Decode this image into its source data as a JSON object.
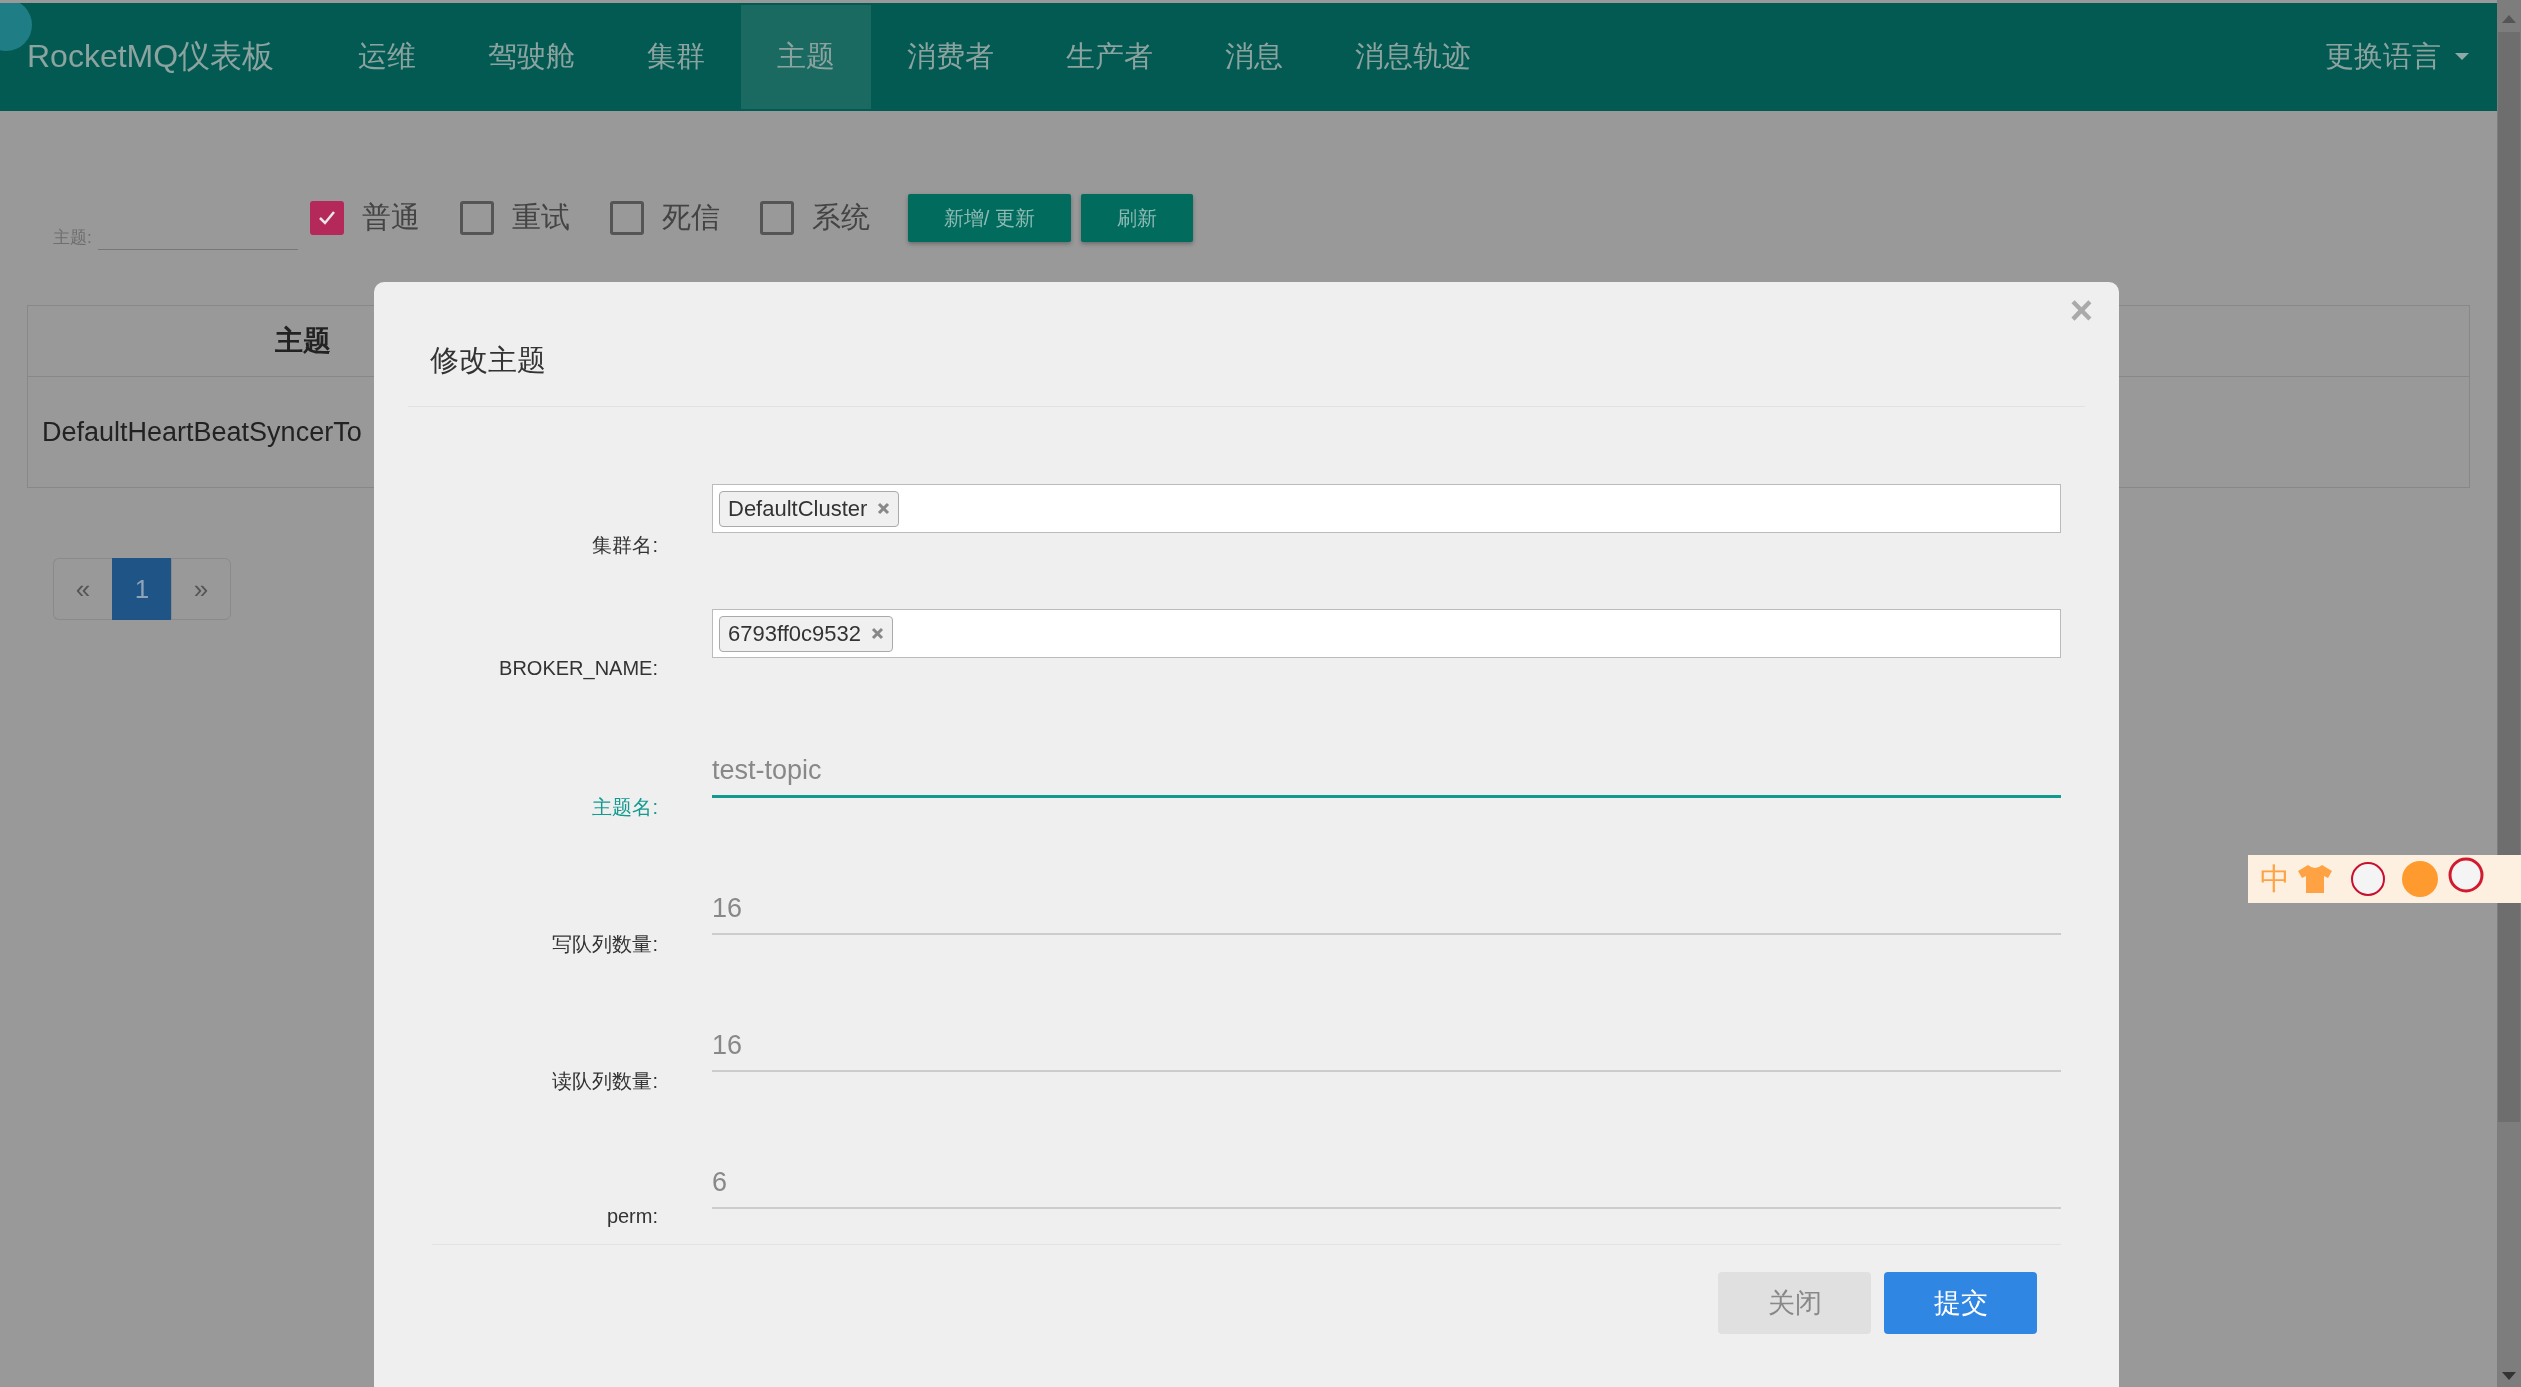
{
  "nav": {
    "brand": "RocketMQ仪表板",
    "items": [
      {
        "label": "运维",
        "selected": false
      },
      {
        "label": "驾驶舱",
        "selected": false
      },
      {
        "label": "集群",
        "selected": false
      },
      {
        "label": "主题",
        "selected": true
      },
      {
        "label": "消费者",
        "selected": false
      },
      {
        "label": "生产者",
        "selected": false
      },
      {
        "label": "消息",
        "selected": false
      },
      {
        "label": "消息轨迹",
        "selected": false
      }
    ],
    "language_menu": "更换语言"
  },
  "filter": {
    "label": "主题:",
    "checkboxes": [
      {
        "label": "普通",
        "checked": true
      },
      {
        "label": "重试",
        "checked": false
      },
      {
        "label": "死信",
        "checked": false
      },
      {
        "label": "系统",
        "checked": false
      }
    ],
    "buttons": [
      "新增/ 更新",
      "刷新"
    ]
  },
  "table": {
    "columns": [
      "主题"
    ],
    "rows": [
      [
        "DefaultHeartBeatSyncerTo"
      ]
    ]
  },
  "pagination": {
    "prev": "«",
    "pages": [
      {
        "label": "1",
        "selected": true
      }
    ],
    "next": "»"
  },
  "modal": {
    "title": "修改主题",
    "close": "×",
    "fields": [
      {
        "label": "集群名:",
        "kind": "tags",
        "tags": [
          "DefaultCluster"
        ]
      },
      {
        "label": "BROKER_NAME:",
        "kind": "tags",
        "tags": [
          "6793ff0c9532"
        ]
      },
      {
        "label": "主题名:",
        "kind": "text",
        "value": "test-topic",
        "focused": true
      },
      {
        "label": "写队列数量:",
        "kind": "text",
        "value": "16",
        "focused": false
      },
      {
        "label": "读队列数量:",
        "kind": "text",
        "value": "16",
        "focused": false
      },
      {
        "label": "perm:",
        "kind": "text",
        "value": "6",
        "focused": false
      }
    ],
    "buttons": [
      {
        "label": "关闭",
        "kind": "default"
      },
      {
        "label": "提交",
        "kind": "primary"
      }
    ]
  },
  "ime_toolbar": {
    "mode": "中"
  }
}
